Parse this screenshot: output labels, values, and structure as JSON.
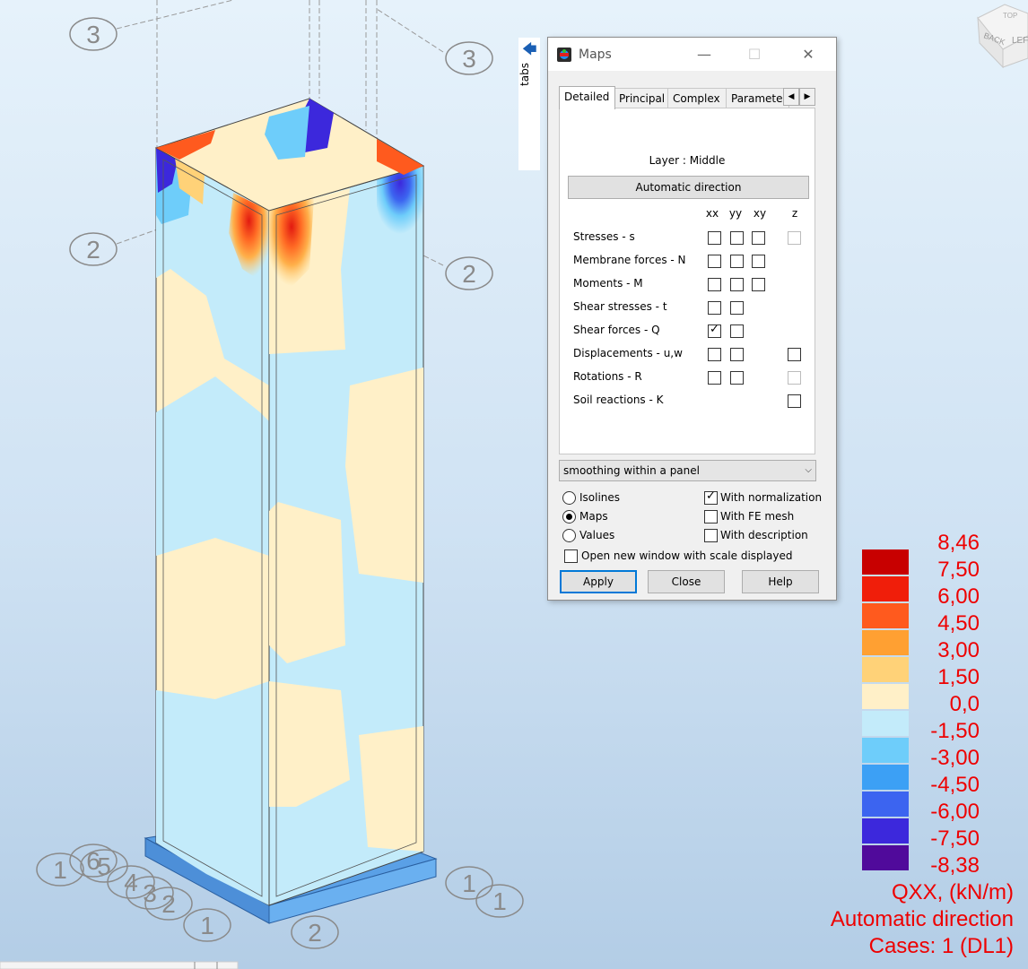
{
  "dialog": {
    "title": "Maps",
    "minimize_glyph": "—",
    "maximize_glyph": "☐",
    "close_glyph": "✕",
    "tabs": [
      "Detailed",
      "Principal",
      "Complex",
      "Parameters"
    ],
    "tab_left_glyph": "◀",
    "tab_right_glyph": "▶",
    "layer_label": "Layer : Middle",
    "automatic_direction_button": "Automatic direction",
    "columns": [
      "xx",
      "yy",
      "xy",
      "z"
    ],
    "rows": [
      {
        "label": "Stresses - s",
        "xx": "unchecked",
        "yy": "unchecked",
        "xy": "unchecked",
        "z": "disabled"
      },
      {
        "label": "Membrane forces - N",
        "xx": "unchecked",
        "yy": "unchecked",
        "xy": "unchecked",
        "z": "none"
      },
      {
        "label": "Moments - M",
        "xx": "unchecked",
        "yy": "unchecked",
        "xy": "unchecked",
        "z": "none"
      },
      {
        "label": "Shear stresses - t",
        "xx": "unchecked",
        "yy": "unchecked",
        "xy": "none",
        "z": "none"
      },
      {
        "label": "Shear forces - Q",
        "xx": "checked",
        "yy": "unchecked",
        "xy": "none",
        "z": "none"
      },
      {
        "label": "Displacements - u,w",
        "xx": "unchecked",
        "yy": "unchecked",
        "xy": "none",
        "z": "unchecked"
      },
      {
        "label": "Rotations - R",
        "xx": "unchecked",
        "yy": "unchecked",
        "xy": "none",
        "z": "disabled"
      },
      {
        "label": "Soil reactions - K",
        "xx": "none",
        "yy": "none",
        "xy": "none",
        "z": "unchecked"
      }
    ],
    "smoothing_select": "smoothing within a panel",
    "smoothing_chevron": "⌵",
    "display_mode": {
      "options": [
        "Isolines",
        "Maps",
        "Values"
      ],
      "selected": "Maps"
    },
    "options": [
      {
        "label": "With normalization",
        "checked": true
      },
      {
        "label": "With FE mesh",
        "checked": false
      },
      {
        "label": "With description",
        "checked": false
      }
    ],
    "open_new_window": {
      "label": "Open new window with scale displayed",
      "checked": false
    },
    "buttons": {
      "apply": "Apply",
      "close": "Close",
      "help": "Help"
    }
  },
  "tabs_strip": {
    "label": "tabs",
    "arrow_glyph": "🡄"
  },
  "view_cube": {
    "labels": [
      "BACK",
      "LEFT",
      "TOP"
    ]
  },
  "grid_bubbles": [
    "3",
    "3",
    "2",
    "2",
    "1",
    "6",
    "5",
    "4",
    "3",
    "2",
    "1",
    "2",
    "1",
    "1"
  ],
  "legend": {
    "values": [
      "8,46",
      "7,50",
      "6,00",
      "4,50",
      "3,00",
      "1,50",
      "0,0",
      "-1,50",
      "-3,00",
      "-4,50",
      "-6,00",
      "-7,50",
      "-8,38"
    ],
    "colors": [
      "#c80000",
      "#f01e0a",
      "#ff5a1e",
      "#ffa032",
      "#ffd278",
      "#fff0c8",
      "#c3ebfa",
      "#6ecdfa",
      "#3ca0f5",
      "#3c64f0",
      "#3c28dc",
      "#500a9b"
    ],
    "text_color": "#ee0000",
    "quantity": "QXX, (kN/m)",
    "direction": "Automatic direction",
    "cases": "Cases: 1 (DL1)"
  }
}
